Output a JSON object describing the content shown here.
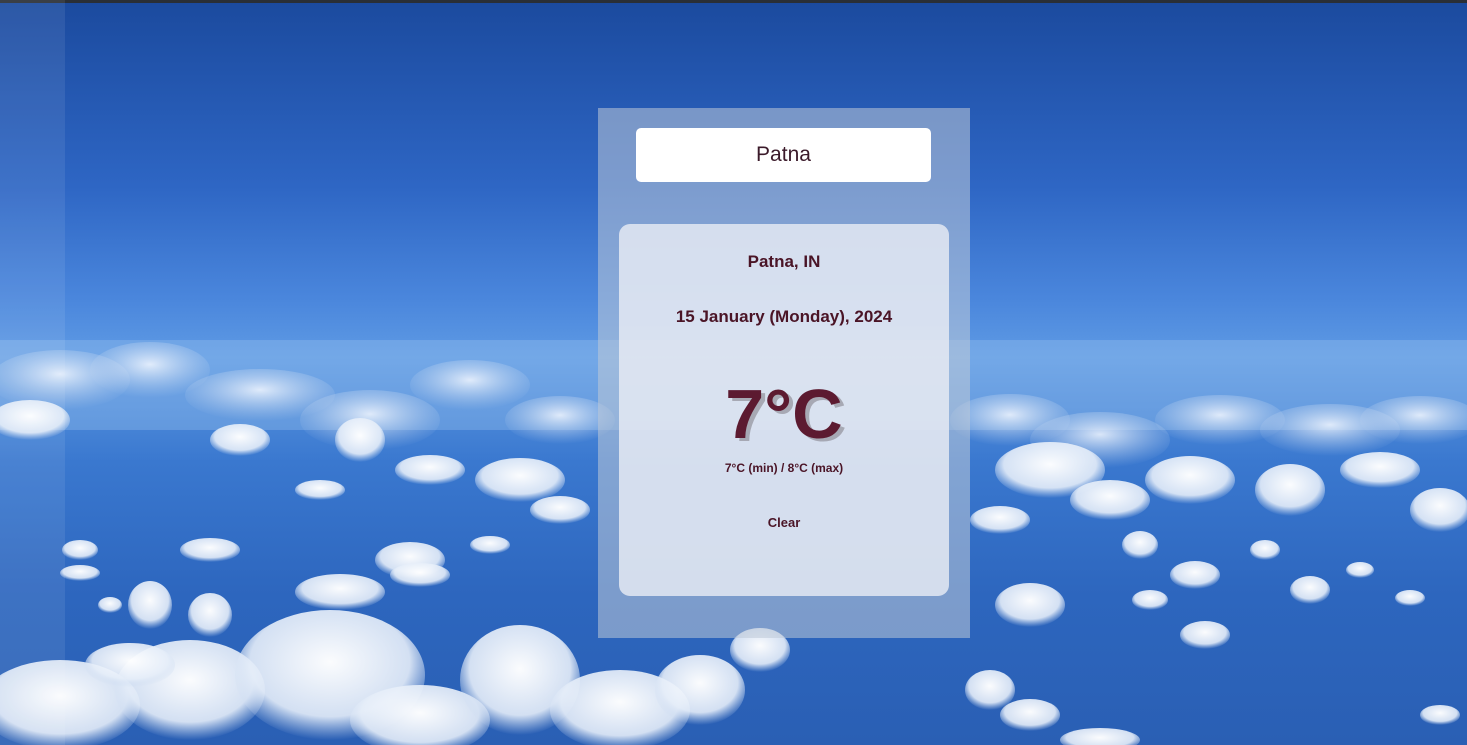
{
  "search": {
    "value": "Patna",
    "placeholder": ""
  },
  "weather": {
    "location": "Patna, IN",
    "date": "15 January (Monday), 2024",
    "temperature": "7°C",
    "min_max": "7°C (min) / 8°C (max)",
    "condition": "Clear"
  },
  "colors": {
    "text": "#4a1426",
    "temperature": "#5c1a30",
    "sky": "#2e66c4"
  }
}
